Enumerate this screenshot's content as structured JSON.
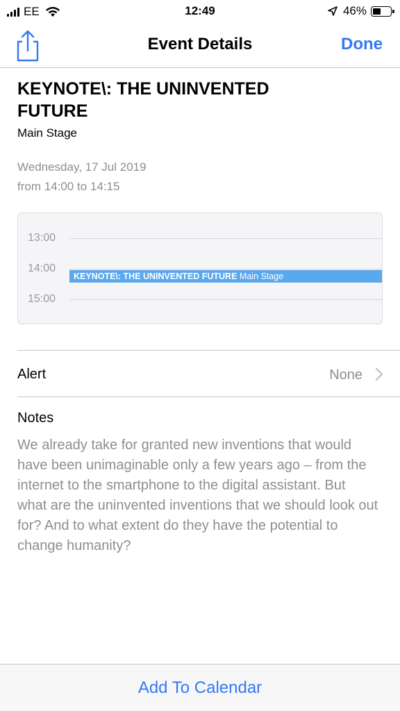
{
  "status_bar": {
    "carrier": "EE",
    "time": "12:49",
    "battery": "46%",
    "battery_level": 0.46
  },
  "nav": {
    "title": "Event Details",
    "done_label": "Done",
    "share_icon": "share-icon"
  },
  "event": {
    "title": "KEYNOTE\\: THE UNINVENTED FUTURE",
    "location": "Main Stage",
    "date": "Wednesday, 17 Jul 2019",
    "time_range": "from 14:00 to 14:15"
  },
  "day_preview": {
    "hours": [
      "13:00",
      "14:00",
      "15:00"
    ],
    "event_title": "KEYNOTE\\: THE UNINVENTED FUTURE",
    "event_location": "Main Stage",
    "event_color": "#5aa8ee"
  },
  "alert": {
    "label": "Alert",
    "value": "None"
  },
  "notes": {
    "label": "Notes",
    "text": "We already take for granted new inventions that would have been unimaginable only a few years ago – from the internet to the smartphone to the digital assistant. But what are the uninvented inventions that we should look out for? And to what extent do they have the potential to change humanity?"
  },
  "toolbar": {
    "add_label": "Add To Calendar"
  },
  "colors": {
    "accent": "#3478f6",
    "secondary_text": "#8e8e93"
  }
}
